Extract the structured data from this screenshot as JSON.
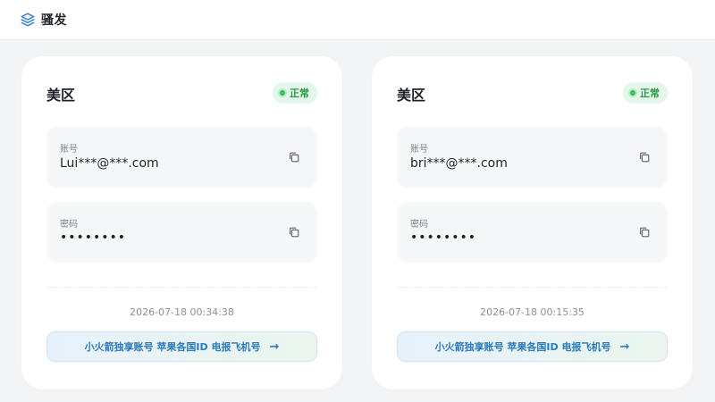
{
  "app": {
    "title": "骚发",
    "brand_icon": "layers-icon"
  },
  "cards": [
    {
      "region": "美区",
      "status": "正常",
      "status_color": "#2a9b46",
      "account_label": "账号",
      "account_value": "Lui***@***.com",
      "password_label": "密码",
      "password_value": "••••••••",
      "timestamp": "2026-07-18 00:34:38",
      "promo_text": "小火箭独享账号 苹果各国ID 电报飞机号",
      "promo_arrow": "→"
    },
    {
      "region": "美区",
      "status": "正常",
      "status_color": "#2a9b46",
      "account_label": "账号",
      "account_value": "bri***@***.com",
      "password_label": "密码",
      "password_value": "••••••••",
      "timestamp": "2026-07-18 00:15:35",
      "promo_text": "小火箭独享账号 苹果各国ID 电报飞机号",
      "promo_arrow": "→"
    }
  ]
}
